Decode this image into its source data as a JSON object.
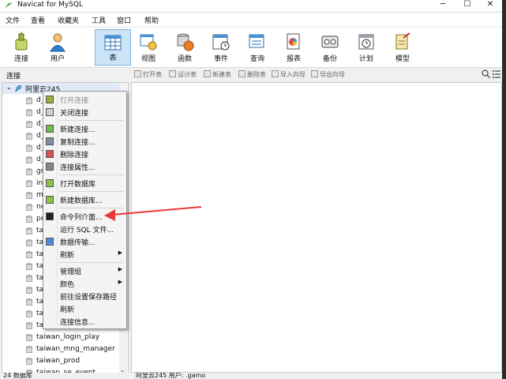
{
  "window": {
    "title": "Navicat for MySQL",
    "controls": {
      "minimize": "─",
      "maximize": "☐",
      "close": "✕"
    }
  },
  "menu": [
    "文件",
    "查看",
    "收藏夹",
    "工具",
    "窗口",
    "帮助"
  ],
  "toolbar": {
    "items": [
      {
        "label": "连接",
        "icon": "connect-icon"
      },
      {
        "label": "用户",
        "icon": "user-icon"
      },
      {
        "label": "表",
        "icon": "table-icon",
        "active": true
      },
      {
        "label": "视图",
        "icon": "view-icon"
      },
      {
        "label": "函数",
        "icon": "function-icon"
      },
      {
        "label": "事件",
        "icon": "event-icon"
      },
      {
        "label": "查询",
        "icon": "query-icon"
      },
      {
        "label": "报表",
        "icon": "report-icon"
      },
      {
        "label": "备份",
        "icon": "backup-icon"
      },
      {
        "label": "计划",
        "icon": "schedule-icon"
      },
      {
        "label": "模型",
        "icon": "model-icon"
      }
    ]
  },
  "left_panel": {
    "header": "连接",
    "root": {
      "label": "阿里云245",
      "expanded": true
    },
    "databases": [
      "d_",
      "d_",
      "d_",
      "d_",
      "d_",
      "d_",
      "gr",
      "inf",
      "m",
      "ne",
      "pe",
      "ta",
      "ta",
      "ta",
      "ta",
      "ta",
      "ta",
      "ta",
      "ta",
      "ta",
      "taiwan_login_play",
      "taiwan_mng_manager",
      "taiwan_prod",
      "taiwan_se_event"
    ]
  },
  "object_toolbar": [
    "打开表",
    "设计表",
    "新建表",
    "删除表",
    "导入向导",
    "导出向导"
  ],
  "status_bar": {
    "left": "24 数据库",
    "right": "阿里云245   用户: .gamo"
  },
  "context_menu": {
    "items": [
      {
        "label": "打开连接",
        "disabled": true
      },
      {
        "label": "关闭连接"
      },
      {
        "sep": true
      },
      {
        "label": "新建连接..."
      },
      {
        "label": "复制连接..."
      },
      {
        "label": "删除连接"
      },
      {
        "label": "连接属性..."
      },
      {
        "sep": true
      },
      {
        "label": "打开数据库"
      },
      {
        "sep": true
      },
      {
        "label": "新建数据库..."
      },
      {
        "sep": true
      },
      {
        "label": "命令列介面..."
      },
      {
        "label": "运行 SQL 文件..."
      },
      {
        "label": "数据传输..."
      },
      {
        "label": "刷新",
        "submenu": true
      },
      {
        "sep": true
      },
      {
        "label": "管理组",
        "submenu": true
      },
      {
        "label": "颜色",
        "submenu": true
      },
      {
        "label": "前往设置保存路径"
      },
      {
        "label": "刷新"
      },
      {
        "label": "连接信息..."
      }
    ]
  },
  "annotation": {
    "arrow_color": "#e8393a"
  }
}
